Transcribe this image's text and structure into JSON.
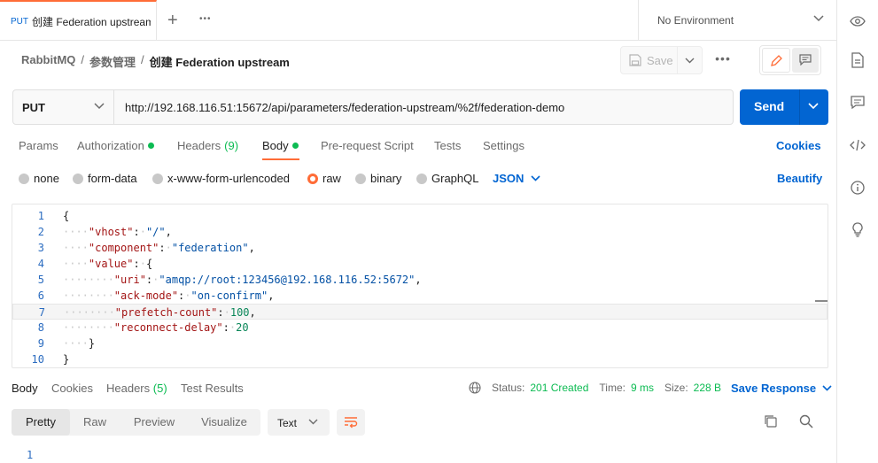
{
  "tab": {
    "method": "PUT",
    "name": "创建 Federation upstream"
  },
  "tab_actions": {
    "new_tab": "+",
    "more": "•••"
  },
  "environment": {
    "label": "No Environment"
  },
  "breadcrumb": {
    "collection": "RabbitMQ",
    "sep1": "/",
    "folder": "参数管理",
    "sep2": "/",
    "request": "创建 Federation upstream"
  },
  "toolbar": {
    "save_label": "Save",
    "more": "•••"
  },
  "request": {
    "method": "PUT",
    "url": "http://192.168.116.51:15672/api/parameters/federation-upstream/%2f/federation-demo",
    "send_label": "Send"
  },
  "request_tabs": {
    "params": "Params",
    "authorization": "Authorization",
    "headers": "Headers",
    "headers_count": "(9)",
    "body": "Body",
    "prerequest": "Pre-request Script",
    "tests": "Tests",
    "settings": "Settings",
    "cookies": "Cookies"
  },
  "body_types": {
    "none": "none",
    "form_data": "form-data",
    "urlencoded": "x-www-form-urlencoded",
    "raw": "raw",
    "binary": "binary",
    "graphql": "GraphQL",
    "format": "JSON",
    "beautify": "Beautify"
  },
  "editor": {
    "lines": [
      {
        "n": "1",
        "text": "{"
      },
      {
        "n": "2",
        "text": "····\"vhost\":·\"/\","
      },
      {
        "n": "3",
        "text": "····\"component\":·\"federation\","
      },
      {
        "n": "4",
        "text": "····\"value\":·{"
      },
      {
        "n": "5",
        "text": "········\"uri\":·\"amqp://root:123456@192.168.116.52:5672\","
      },
      {
        "n": "6",
        "text": "········\"ack-mode\":·\"on-confirm\","
      },
      {
        "n": "7",
        "text": "········\"prefetch-count\":·100,"
      },
      {
        "n": "8",
        "text": "········\"reconnect-delay\":·20"
      },
      {
        "n": "9",
        "text": "····}"
      },
      {
        "n": "10",
        "text": "}"
      }
    ]
  },
  "response": {
    "tabs": {
      "body": "Body",
      "cookies": "Cookies",
      "headers": "Headers",
      "headers_count": "(5)",
      "test_results": "Test Results"
    },
    "status_label": "Status:",
    "status_value": "201 Created",
    "time_label": "Time:",
    "time_value": "9 ms",
    "size_label": "Size:",
    "size_value": "228 B",
    "save_response": "Save Response",
    "views": {
      "pretty": "Pretty",
      "raw": "Raw",
      "preview": "Preview",
      "visualize": "Visualize"
    },
    "format": "Text",
    "first_line": "1"
  },
  "colors": {
    "accent": "#ff6c37",
    "primary": "#0265d2",
    "success": "#0cbb52"
  }
}
